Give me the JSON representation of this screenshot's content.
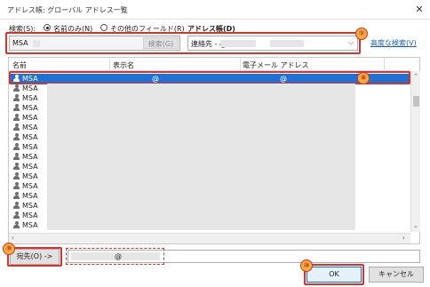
{
  "window": {
    "title": "アドレス帳: グローバル アドレス一覧",
    "close_glyph": "✕"
  },
  "search": {
    "label": "検索(S):",
    "radio_name_only": "名前のみ(N)",
    "radio_other_fields": "その他のフィールド(R)",
    "value": "MSA",
    "search_button": "検索(G)"
  },
  "address_book": {
    "label": "アドレス帳(D)",
    "value": "連絡先 -                    @",
    "advanced_search": "高度な検索(V)"
  },
  "list": {
    "columns": [
      "名前",
      "表示名",
      "電子メール アドレス"
    ],
    "selected_row": {
      "name": "MSA",
      "display": "@",
      "email": "@"
    },
    "rows": [
      "MSA",
      "MSA",
      "MSA",
      "MSA",
      "MSA",
      "MSA",
      "MSA",
      "MSA",
      "MSA",
      "MSA",
      "MSA",
      "MSA",
      "MSA",
      "MSA",
      "MSA",
      "MSA"
    ]
  },
  "recipients": {
    "to_button": "宛先(O) ->",
    "to_value": "@"
  },
  "buttons": {
    "ok": "OK",
    "cancel": "キャンセル"
  },
  "annotations": {
    "b7": "⑦",
    "b8": "⑧",
    "b9": "⑨",
    "b10": "⑩"
  },
  "colors": {
    "accent": "#1e72d6",
    "annotation_red": "#d9312b",
    "badge_fill": "#f4ae3c"
  }
}
